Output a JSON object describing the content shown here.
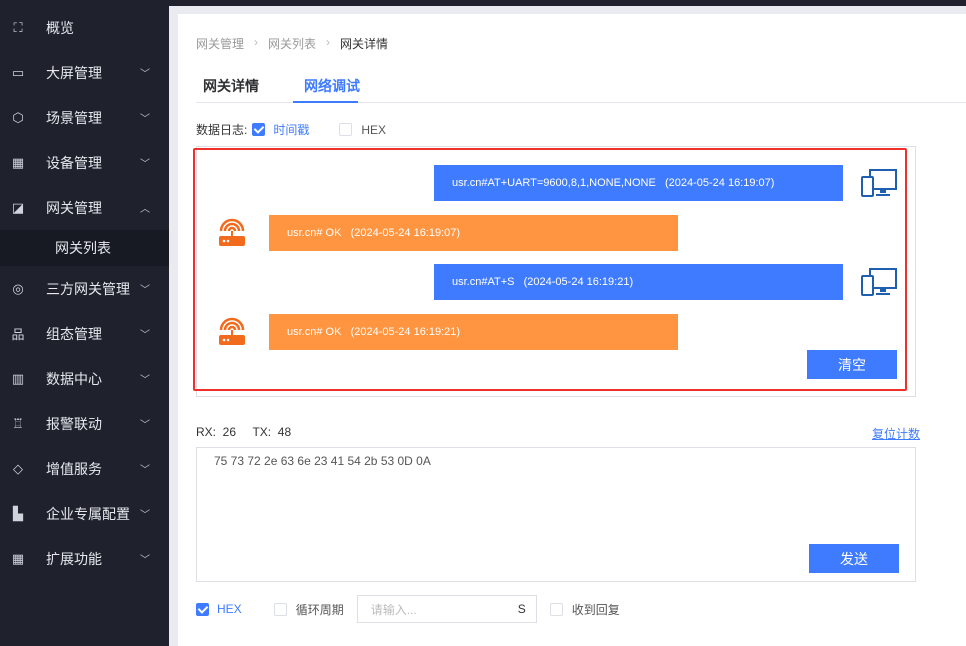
{
  "sidebar": {
    "items": [
      {
        "label": "概览",
        "icon": "scan-icon",
        "chevron": ""
      },
      {
        "label": "大屏管理",
        "icon": "monitor-chart-icon",
        "chevron": "﹀"
      },
      {
        "label": "场景管理",
        "icon": "cube-icon",
        "chevron": "﹀"
      },
      {
        "label": "设备管理",
        "icon": "grid-icon",
        "chevron": "﹀"
      },
      {
        "label": "网关管理",
        "icon": "chart-box-icon",
        "chevron": "︿"
      },
      {
        "label": "三方网关管理",
        "icon": "network-icon",
        "chevron": "﹀"
      },
      {
        "label": "组态管理",
        "icon": "hierarchy-icon",
        "chevron": "﹀"
      },
      {
        "label": "数据中心",
        "icon": "bar-chart-icon",
        "chevron": "﹀"
      },
      {
        "label": "报警联动",
        "icon": "alarm-icon",
        "chevron": "﹀"
      },
      {
        "label": "增值服务",
        "icon": "diamond-icon",
        "chevron": "﹀"
      },
      {
        "label": "企业专属配置",
        "icon": "building-icon",
        "chevron": "﹀"
      },
      {
        "label": "扩展功能",
        "icon": "apps-icon",
        "chevron": "﹀"
      }
    ],
    "subitem": "网关列表"
  },
  "breadcrumb": [
    "网关管理",
    "网关列表",
    "网关详情"
  ],
  "tabs": [
    "网关详情",
    "网络调试"
  ],
  "log_options": {
    "label": "数据日志:",
    "timestamp": "时间戳",
    "timestamp_checked": true,
    "hex": "HEX",
    "hex_checked": false
  },
  "messages": [
    {
      "dir": "tx",
      "text": "usr.cn#AT+UART=9600,8,1,NONE,NONE   (2024-05-24 16:19:07)"
    },
    {
      "dir": "rx",
      "text": "usr.cn# OK   (2024-05-24 16:19:07)"
    },
    {
      "dir": "tx",
      "text": "usr.cn#AT+S   (2024-05-24 16:19:21)"
    },
    {
      "dir": "rx",
      "text": "usr.cn# OK   (2024-05-24 16:19:21)"
    }
  ],
  "clear_label": "清空",
  "counts": "RX:  26     TX:  48",
  "reset_label": "复位计数",
  "send_text": "75 73 72 2e 63 6e 23 41 54 2b 53 0D 0A",
  "send_label": "发送",
  "bottom": {
    "hex": "HEX",
    "hex_checked": true,
    "loop": "循环周期",
    "loop_checked": false,
    "period_placeholder": "请输入...",
    "unit": "S",
    "reply": "收到回复",
    "reply_checked": false
  },
  "colors": {
    "accent": "#3f7bff",
    "orange": "#ff9540",
    "highlight": "#f0302a"
  }
}
